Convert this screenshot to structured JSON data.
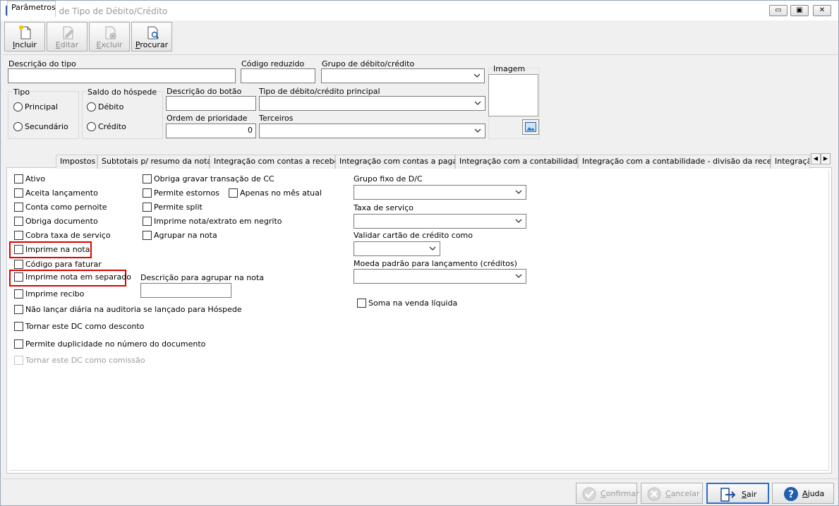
{
  "window": {
    "title": "Cadastro de Tipo de Débito/Crédito",
    "controls": {
      "minimize": "▭",
      "restore": "▣",
      "close": "✕"
    }
  },
  "toolbar": {
    "incluir": {
      "first": "I",
      "rest": "ncluir",
      "enabled": true
    },
    "editar": {
      "first": "E",
      "rest": "ditar",
      "enabled": false
    },
    "excluir": {
      "first": "E",
      "rest": "xcluir",
      "enabled": false
    },
    "procurar": {
      "first": "P",
      "rest": "rocurar",
      "enabled": true
    }
  },
  "header": {
    "descricao_label": "Descrição do tipo",
    "descricao_value": "",
    "codigo_label": "Código reduzido",
    "codigo_value": "",
    "grupo_label": "Grupo de débito/crédito",
    "grupo_value": "",
    "imagem_label": "Imagem",
    "tipo_label": "Tipo",
    "tipo_options": [
      "Principal",
      "Secundário"
    ],
    "saldo_label": "Saldo do hóspede",
    "saldo_options": [
      "Débito",
      "Crédito"
    ],
    "desc_botao_label": "Descrição do botão",
    "desc_botao_value": "",
    "tipo_principal_label": "Tipo de débito/crédito principal",
    "tipo_principal_value": "",
    "ordem_label": "Ordem de prioridade",
    "ordem_value": "0",
    "terceiros_label": "Terceiros",
    "terceiros_value": ""
  },
  "tabs": [
    "Parâmetros",
    "Impostos",
    "Subtotais p/ resumo da nota",
    "Integração com contas a receber",
    "Integração com contas a pagar",
    "Integração com a contabilidade",
    "Integração com a contabilidade - divisão da receita",
    "Integraçã"
  ],
  "params": {
    "col1": [
      "Ativo",
      "Aceita lançamento",
      "Conta como pernoite",
      "Obriga documento",
      "Cobra taxa de serviço",
      "Imprime na nota",
      "Código para faturar",
      "Imprime nota em separado",
      "Imprime recibo",
      "Não lançar diária na auditoria se lançado para Hóspede",
      "Tornar este DC como desconto",
      "Permite duplicidade no número do documento",
      "Tornar este DC como comissão"
    ],
    "col2": [
      "Obriga gravar transação de CC",
      "Permite estornos",
      "Permite split",
      "Imprime nota/extrato em negrito",
      "Agrupar na nota"
    ],
    "apenas_mes": "Apenas no mês atual",
    "desc_agrupar_label": "Descrição para agrupar na nota",
    "desc_agrupar_value": "",
    "grupo_fixo_label": "Grupo fixo de D/C",
    "grupo_fixo_value": "",
    "taxa_servico_label": "Taxa de serviço",
    "taxa_servico_value": "",
    "validar_label": "Validar cartão de crédito como",
    "validar_value": "",
    "moeda_label": "Moeda padrão para lançamento (créditos)",
    "moeda_value": "",
    "soma_label": "Soma na venda líquida"
  },
  "footer": {
    "confirmar": {
      "first": "C",
      "rest": "onfirmar",
      "enabled": false
    },
    "cancelar": {
      "first": "C",
      "rest": "ancelar",
      "enabled": false
    },
    "sair": {
      "first": "S",
      "rest": "air",
      "enabled": true
    },
    "ajuda": {
      "first": "A",
      "rest": "juda",
      "enabled": true
    }
  },
  "colors": {
    "highlight": "#e00000",
    "primary_border": "#2b6cd2"
  }
}
